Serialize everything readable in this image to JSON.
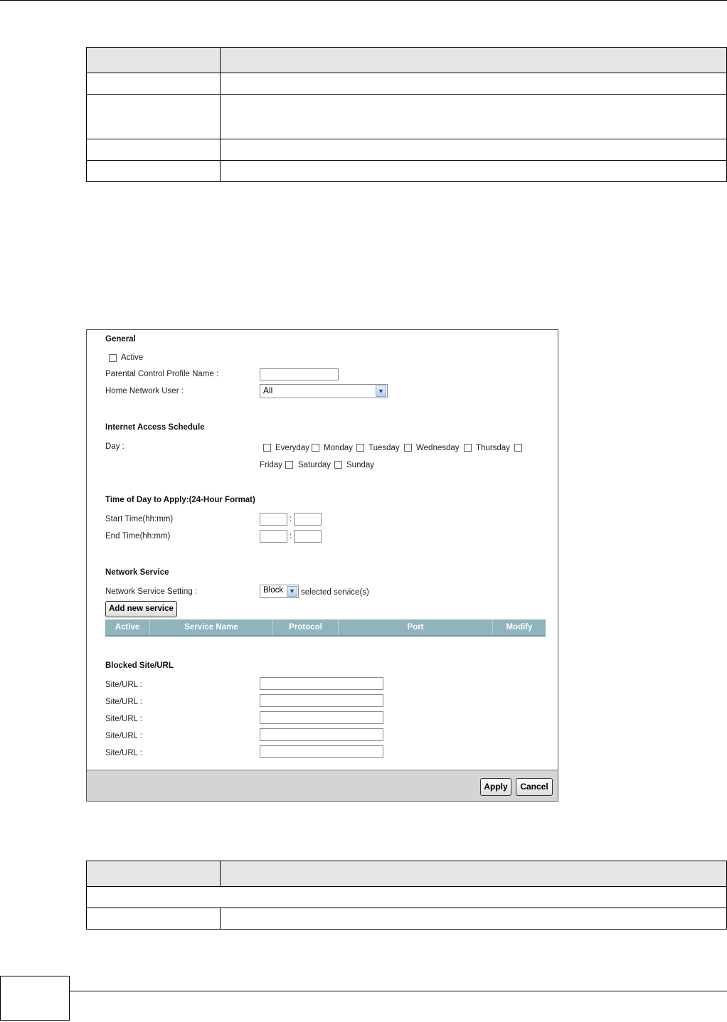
{
  "panel": {
    "general": {
      "heading": "General",
      "active_label": "Active",
      "profile_name_label": "Parental Control Profile Name :",
      "profile_name_value": "",
      "home_user_label": "Home Network User :",
      "home_user_value": "All"
    },
    "schedule": {
      "heading": "Internet Access Schedule",
      "day_label": "Day :",
      "days": [
        "Everyday",
        "Monday",
        "Tuesday",
        "Wednesday",
        "Thursday",
        "Friday",
        "Saturday",
        "Sunday"
      ]
    },
    "time": {
      "heading": "Time of Day to Apply:(24-Hour Format)",
      "start_label": "Start Time(hh:mm)",
      "end_label": "End Time(hh:mm)",
      "separator": ":"
    },
    "network_service": {
      "heading": "Network Service",
      "setting_label": "Network Service Setting :",
      "setting_value": "Block",
      "setting_suffix": "selected service(s)",
      "add_button": "Add new service",
      "columns": [
        "Active",
        "Service Name",
        "Protocol",
        "Port",
        "Modify"
      ]
    },
    "blocked": {
      "heading": "Blocked Site/URL",
      "rows": [
        "Site/URL :",
        "Site/URL :",
        "Site/URL :",
        "Site/URL :",
        "Site/URL :"
      ]
    },
    "buttons": {
      "apply": "Apply",
      "cancel": "Cancel"
    }
  },
  "icons": {
    "dropdown": "chevron-down-icon"
  }
}
